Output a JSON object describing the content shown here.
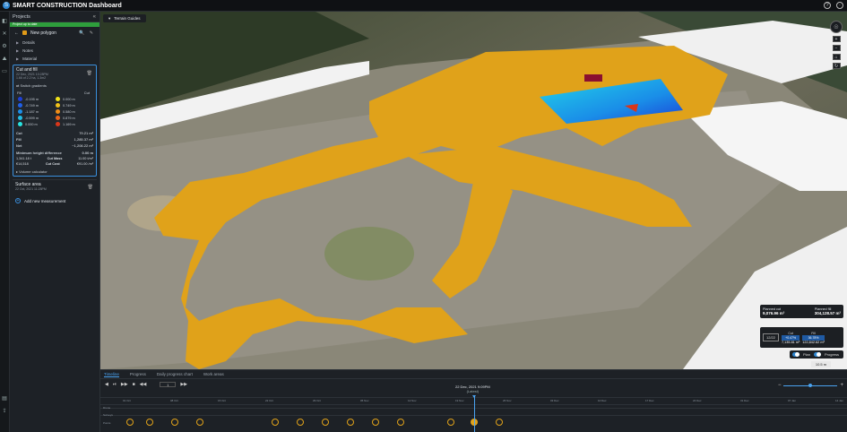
{
  "app": {
    "title": "SMART CONSTRUCTION Dashboard",
    "logo_glyph": "S"
  },
  "topbar": {
    "help_glyph": "?",
    "user_glyph": "·"
  },
  "sidebar": {
    "header": "Projects",
    "collapse_glyph": "«",
    "status_strip": "Project up to date",
    "polygon": {
      "name": "New polygon",
      "tools": "🔍 ✎",
      "back_glyph": "←"
    },
    "sections": [
      "Details",
      "Notes",
      "Material"
    ],
    "cutfill": {
      "title": "Cut and fill",
      "date": "22 Dec, 2021 10:28PM",
      "subtitle": "1.66 of 2.2 ha, 1.3m2",
      "switch_label": "Switch gradients",
      "fill_label": "Fill",
      "cut_label": "Cut",
      "gradients": [
        {
          "label": "-0.195 m",
          "color": "#1e3fd6"
        },
        {
          "label": "0.000 m",
          "color": "#f2e41a"
        },
        {
          "label": "-0.749 m",
          "color": "#2060e8"
        },
        {
          "label": "0.749 m",
          "color": "#f3c21a"
        },
        {
          "label": "-1.187 m",
          "color": "#1c8ee8"
        },
        {
          "label": "0.580 m",
          "color": "#ef8d17"
        },
        {
          "label": "-0.599 m",
          "color": "#22bde6"
        },
        {
          "label": "0.879 m",
          "color": "#e8641a"
        },
        {
          "label": "0.000 m",
          "color": "#28e3e0"
        },
        {
          "label": "1.169 m",
          "color": "#d9361a"
        }
      ],
      "values": [
        {
          "k": "Cut",
          "v": "79.21 m³"
        },
        {
          "k": "Fill",
          "v": "1,285.37 m³"
        },
        {
          "k": "Net",
          "v": "−1,206.22 m³"
        }
      ],
      "min_height_label": "Minimum height difference",
      "min_height_value": "0.00 m",
      "cost_left": "1,341.18 t",
      "cost_mid_label": "Cut Mass",
      "cost_mid_val": "11.00 t/m³",
      "cost_left2": "€14,518",
      "cost_right_label": "Cut Cost",
      "cost_right_val": "€91.00 /m³",
      "volume_calc": "Volume calculator"
    },
    "surface": {
      "title": "Surface area",
      "date": "22 Oct, 2021 11:28PM"
    },
    "add_label": "Add new measurement"
  },
  "map": {
    "terrain_label": "Terrain Guides",
    "compass_glyph": "☉",
    "nav_buttons": [
      "+",
      "−",
      "⌂",
      "↻"
    ],
    "volumes": {
      "planned_cut_label": "Planned cut",
      "planned_cut_value": "9,076.96 m³",
      "planned_fill_label": "Planned fill",
      "planned_fill_value": "304,128.57 m³"
    },
    "cf": {
      "date": "12/22",
      "cut_label": "Cut",
      "cut_pct": "+0.47%",
      "cut_value": "7,135.81 m³",
      "fill_label": "Fill",
      "fill_pct": "36.78%",
      "fill_value": "122,842.62 m³"
    },
    "toggles": {
      "plan": "Plan",
      "progress": "Progress"
    },
    "scale": "10.5 m"
  },
  "timeline": {
    "tabs": [
      "Timeline",
      "Progress",
      "Daily progress chart",
      "Work areas"
    ],
    "controls": [
      "◀",
      "⏯",
      "▶▶",
      "■",
      "◀◀"
    ],
    "frame_value": "1",
    "current_date": "22 Dec, 2021 9:09PM",
    "current_sub": "(Latest)",
    "zoom_minus": "−",
    "zoom_plus": "+",
    "ruler": [
      "01 Oct",
      "08 Oct",
      "15 Oct",
      "22 Oct",
      "29 Oct",
      "05 Nov",
      "12 Nov",
      "19 Nov",
      "26 Nov",
      "03 Dec",
      "10 Dec",
      "17 Dec",
      "24 Dec",
      "31 Dec",
      "07 Jan",
      "14 Jan"
    ],
    "tracks": [
      "Drone",
      "Surveys",
      "Points"
    ],
    "markers_on": [
      false,
      false,
      false,
      false,
      false,
      false,
      false,
      false,
      false,
      false,
      false,
      true,
      false
    ]
  },
  "colors": {
    "accent": "#2f86d0",
    "fill_orange": "#e0a21a",
    "green_strip": "#2e9e3c"
  }
}
